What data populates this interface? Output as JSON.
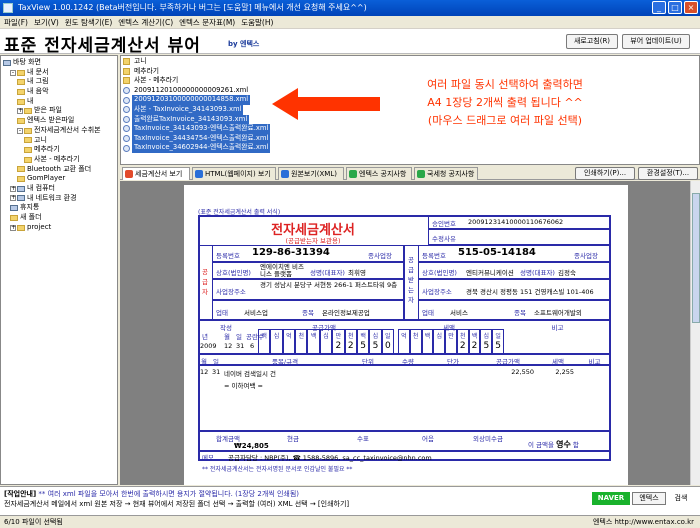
{
  "window": {
    "title": "TaxView 1.00.1242 (Beta버전입니다. 부족하거나 버그는 [도움말] 메뉴에서 개선 요청해 주세요^^)"
  },
  "menu": [
    "파일(F)",
    "보기(V)",
    "윈도 탐색기(E)",
    "엔텍스 계산기(C)",
    "엔텍스 문자표(M)",
    "도움말(H)"
  ],
  "header": {
    "title": "표준 전자세금계산서 뷰어",
    "by": "by 엔텍스",
    "refresh_button": "새로고침(R)",
    "update_button": "뷰어 업데이트(U)"
  },
  "tree": [
    {
      "label": "바탕 화면",
      "icon": "desktop",
      "indent": 0,
      "exp": ""
    },
    {
      "label": "내 문서",
      "icon": "folder",
      "indent": 1,
      "exp": "-"
    },
    {
      "label": "내 그림",
      "icon": "folder",
      "indent": 2,
      "exp": ""
    },
    {
      "label": "내 음악",
      "icon": "folder",
      "indent": 2,
      "exp": ""
    },
    {
      "label": "내",
      "icon": "folder",
      "indent": 2,
      "exp": ""
    },
    {
      "label": "받은 파일",
      "icon": "folder",
      "indent": 2,
      "exp": "+"
    },
    {
      "label": "엔텍스 받은파일",
      "icon": "folder",
      "indent": 2,
      "exp": ""
    },
    {
      "label": "전자세금계산서 수취본",
      "icon": "folder",
      "indent": 2,
      "exp": "-"
    },
    {
      "label": "고니",
      "icon": "folder",
      "indent": 3,
      "exp": ""
    },
    {
      "label": "메추라기",
      "icon": "folder",
      "indent": 3,
      "exp": ""
    },
    {
      "label": "사본 - 메추라기",
      "icon": "folder",
      "indent": 3,
      "exp": ""
    },
    {
      "label": "Bluetooth 교환 폴더",
      "icon": "folder",
      "indent": 2,
      "exp": ""
    },
    {
      "label": "GomPlayer",
      "icon": "folder",
      "indent": 2,
      "exp": ""
    },
    {
      "label": "내 컴퓨터",
      "icon": "pc",
      "indent": 1,
      "exp": "+"
    },
    {
      "label": "내 네트워크 환경",
      "icon": "pc",
      "indent": 1,
      "exp": "+"
    },
    {
      "label": "휴지통",
      "icon": "pc",
      "indent": 1,
      "exp": ""
    },
    {
      "label": "새 폴더",
      "icon": "folder",
      "indent": 1,
      "exp": ""
    },
    {
      "label": "project",
      "icon": "folder",
      "indent": 1,
      "exp": "+"
    }
  ],
  "files": [
    {
      "name": "고니",
      "type": "folder",
      "selected": false
    },
    {
      "name": "메추라기",
      "type": "folder",
      "selected": false
    },
    {
      "name": "사본 - 메추라기",
      "type": "folder",
      "selected": false
    },
    {
      "name": "20091120100000000009261.xml",
      "type": "xml",
      "selected": false
    },
    {
      "name": "20091203100000000014858.xml",
      "type": "xml",
      "selected": true
    },
    {
      "name": "사본 - TaxInvoice_34143093.xml",
      "type": "xml",
      "selected": true
    },
    {
      "name": "출력완료TaxInvoice_34143093.xml",
      "type": "xml",
      "selected": true
    },
    {
      "name": "TaxInvoice_34143093-엔텍스출력완료.xml",
      "type": "xml",
      "selected": true
    },
    {
      "name": "TaxInvoice_34434754-엔텍스출력완료.xml",
      "type": "xml",
      "selected": true
    },
    {
      "name": "TaxInvoice_34602944-엔텍스출력완료.xml",
      "type": "xml",
      "selected": true
    }
  ],
  "annotation": {
    "lines": [
      "여러 파일 동시 선택하여 출력하면",
      "A4 1장당 2개씩 출력 됩니다 ^^",
      "(마우스 드래그로 여러 파일 선택)"
    ],
    "color": "#ff3300"
  },
  "tabs": [
    {
      "label": "세금계산서 보기",
      "active": true,
      "color": "#e24a2a"
    },
    {
      "label": "HTML(웹페이지) 보기",
      "active": false,
      "color": "#2a6fd8"
    },
    {
      "label": "원본보기(XML)",
      "active": false,
      "color": "#2a6fd8"
    },
    {
      "label": "엔텍스 공지사항",
      "active": false,
      "color": "#2aa84a"
    },
    {
      "label": "국세청 공지사항",
      "active": false,
      "color": "#2aa84a"
    }
  ],
  "tab_buttons": {
    "print": "인쇄하기(P)...",
    "settings": "환경설정(T)..."
  },
  "invoice": {
    "top_note": "(표준 전자세금계산서 출력 서식)",
    "title": "전자세금계산서",
    "subtitle": "(공급받는자 보관용)",
    "approval_label": "승인번호",
    "approval_no": "20091231410000110676062",
    "modify_label": "수정사유",
    "supplier": {
      "side_label": "공급자",
      "regno_label": "등록번호",
      "regno": "129-86-31394",
      "sub_label": "종사업장",
      "name_label": "상호(법인명)",
      "name": "엔에이치엔 비즈니스 플랫폼",
      "rep_label": "성명(대표자)",
      "rep": "최휘영",
      "addr_label": "사업장주소",
      "addr": "경기 성남시 분당구 서현동 266-1 퍼스트타워 9층",
      "type_label": "업태",
      "type": "서비스업",
      "item_label": "종목",
      "item": "온라인정보제공업"
    },
    "buyer": {
      "side_label": "공급받는자",
      "regno_label": "등록번호",
      "regno": "515-05-14184",
      "sub_label": "종사업장",
      "name_label": "상호(법인명)",
      "name": "엔티커뮤니케이션",
      "rep_label": "성명(대표자)",
      "rep": "김정숙",
      "addr_label": "사업장주소",
      "addr": "경북 경산시 정평동 151 건영캐스빌 101-406",
      "type_label": "업태",
      "type": "서비스",
      "item_label": "종목",
      "item": "소프트웨어개발외"
    },
    "date_row": {
      "write_label": "작성",
      "supply_label": "공급가액",
      "tax_label": "세액",
      "remark_label": "비고",
      "cols": [
        "년",
        "월",
        "일",
        "공란수"
      ],
      "year": "2009",
      "month": "12",
      "day": "31",
      "blank": "6",
      "supply_digits": [
        "",
        "",
        "",
        "",
        "",
        "",
        "2",
        "2",
        "5",
        "5",
        "0"
      ],
      "tax_digits": [
        "",
        "",
        "",
        "",
        "",
        "2",
        "2",
        "5",
        "5"
      ],
      "digit_header": [
        "백",
        "십",
        "억",
        "천",
        "백",
        "십",
        "만",
        "천",
        "백",
        "십",
        "일"
      ]
    },
    "item_header": [
      "월",
      "일",
      "품목/규격",
      "단위",
      "수량",
      "단가",
      "공급가액",
      "세액",
      "비고"
    ],
    "items": [
      {
        "month": "12",
        "day": "31",
        "name": "네이버 검색일시 건",
        "unit": "",
        "qty": "",
        "price": "",
        "supply": "22,550",
        "tax": "2,255",
        "note": ""
      },
      {
        "month": "",
        "day": "",
        "name": "= 이하여백 =",
        "unit": "",
        "qty": "",
        "price": "",
        "supply": "",
        "tax": "",
        "note": ""
      }
    ],
    "total": {
      "total_label": "합계금액",
      "cash_label": "현금",
      "check_label": "수표",
      "bill_label": "어음",
      "credit_label": "외상미수금",
      "amount": "₩24,805",
      "claim_prefix": "이 금액을",
      "claim_word": "영수",
      "claim_suffix": "함"
    },
    "memo_label": "메모",
    "memo": "공급자담당 : NBP(주), ☎ 1588-5896, sa_cc_taxinvoice@nhn.com",
    "footnote": "** 전자세금계산서는 전자서명된 문서로 인감날인 불필요 **"
  },
  "bottom": {
    "guide_label": "[작업안내]",
    "guide_line": "** 여러 xml 파일을 모아서 한번에 출력하시면 용지가 절약됩니다. (1장당 2개씩 인쇄됨)",
    "guide_line2": "전자세금계산서 메일에서 xml 원본 저장 → 현재 뷰어에서 저장된 폴더 선택 → 출력할 (여러) XML 선택 → [인쇄하기]",
    "naver": "NAVER",
    "entax_button": "엔텍스",
    "search_button": "검색"
  },
  "status": {
    "left": "6/10 파일이 선택됨",
    "right": "엔텍스 http://www.entax.co.kr"
  }
}
